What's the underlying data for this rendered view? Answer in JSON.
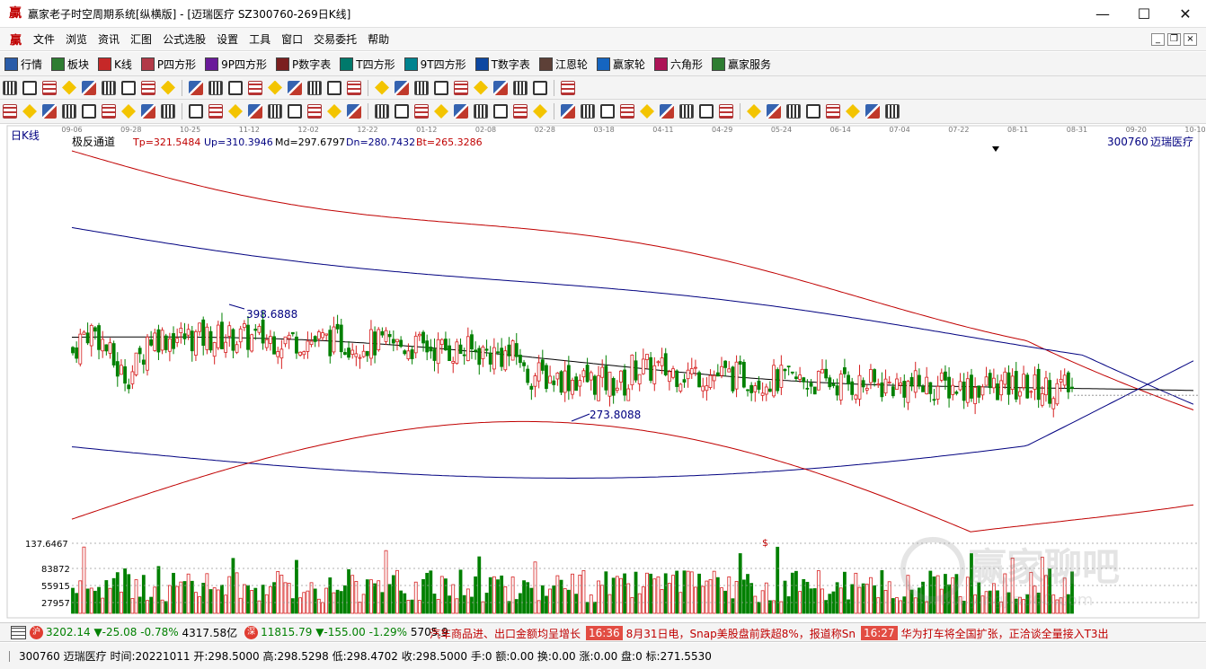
{
  "window": {
    "title": "赢家老子时空周期系统[纵横版] - [迈瑞医疗  SZ300760-269日K线]"
  },
  "menu": [
    "文件",
    "浏览",
    "资讯",
    "汇图",
    "公式选股",
    "设置",
    "工具",
    "窗口",
    "交易委托",
    "帮助"
  ],
  "toolbar1": [
    {
      "label": "行情",
      "icon": "grid-icon"
    },
    {
      "label": "板块",
      "icon": "blocks-icon"
    },
    {
      "label": "K线",
      "icon": "candles-icon"
    },
    {
      "label": "P四方形",
      "icon": "ps-icon"
    },
    {
      "label": "9P四方形",
      "icon": "p9-icon"
    },
    {
      "label": "P数字表",
      "icon": "pn-icon"
    },
    {
      "label": "T四方形",
      "icon": "ts-icon"
    },
    {
      "label": "9T四方形",
      "icon": "t9-icon"
    },
    {
      "label": "T数字表",
      "icon": "tn-icon"
    },
    {
      "label": "江恩轮",
      "icon": "gann-wheel-icon"
    },
    {
      "label": "赢家轮",
      "icon": "winner-wheel-icon"
    },
    {
      "label": "六角形",
      "icon": "hexagon-icon"
    },
    {
      "label": "赢家服务",
      "icon": "dollar-icon"
    }
  ],
  "chart": {
    "period_label": "日K线",
    "indicator_name": "极反通道",
    "indicators": [
      {
        "label": "Tp=321.5484",
        "color": "#c00000"
      },
      {
        "label": "Up=310.3946",
        "color": "#000080"
      },
      {
        "label": "Md=297.6797",
        "color": "#000000"
      },
      {
        "label": "Dn=280.7432",
        "color": "#000080"
      },
      {
        "label": "Bt=265.3286",
        "color": "#c00000"
      }
    ],
    "stock_code": "300760",
    "stock_name": "迈瑞医疗",
    "high_marker": "398.6888",
    "low_marker": "273.8088",
    "dollar_mark": "$",
    "date_ticks": [
      "09-06",
      "09-28",
      "10-25",
      "11-12",
      "12-02",
      "12-22",
      "01-12",
      "02-08",
      "02-28",
      "03-18",
      "04-11",
      "04-29",
      "05-24",
      "06-14",
      "07-04",
      "07-22",
      "08-11",
      "08-31",
      "09-20",
      "10-10"
    ],
    "volume_labels": [
      "137.6467",
      "83872",
      "55915",
      "27957"
    ],
    "watermark": {
      "main": "赢家聊吧",
      "url": "www.yingjia360.com"
    },
    "chart_data": {
      "type": "candlestick",
      "price_range": [
        240,
        410
      ],
      "volume_max": 137.6467,
      "high": 398.6888,
      "low": 273.8088
    }
  },
  "ticker": {
    "sh_badge": "沪",
    "sh_value": "3202.14",
    "sh_change": "▼-25.08",
    "sh_pct": "-0.78%",
    "sh_amount": "4317.58亿",
    "sz_badge": "深",
    "sz_value": "11815.79",
    "sz_change": "▼-155.00",
    "sz_pct": "-1.29%",
    "sz_amount": "5705.9",
    "news": [
      {
        "time": "",
        "text": "汽车商品进、出口金额均呈增长"
      },
      {
        "time": "16:36",
        "text": "8月31日电，Snap美股盘前跌超8%，报道称Sn"
      },
      {
        "time": "16:27",
        "text": "华为打车将全国扩张，正洽谈全量接入T3出"
      }
    ]
  },
  "status": {
    "text": "300760 迈瑞医疗 时间:20221011 开:298.5000 高:298.5298 低:298.4702 收:298.5000 手:0 额:0.00 换:0.00 涨:0.00 盘:0 标:271.5530"
  },
  "colors": {
    "up": "#d62020",
    "down": "#008000",
    "upper_band": "#c00000",
    "inner_band": "#000080",
    "mid": "#000000"
  }
}
